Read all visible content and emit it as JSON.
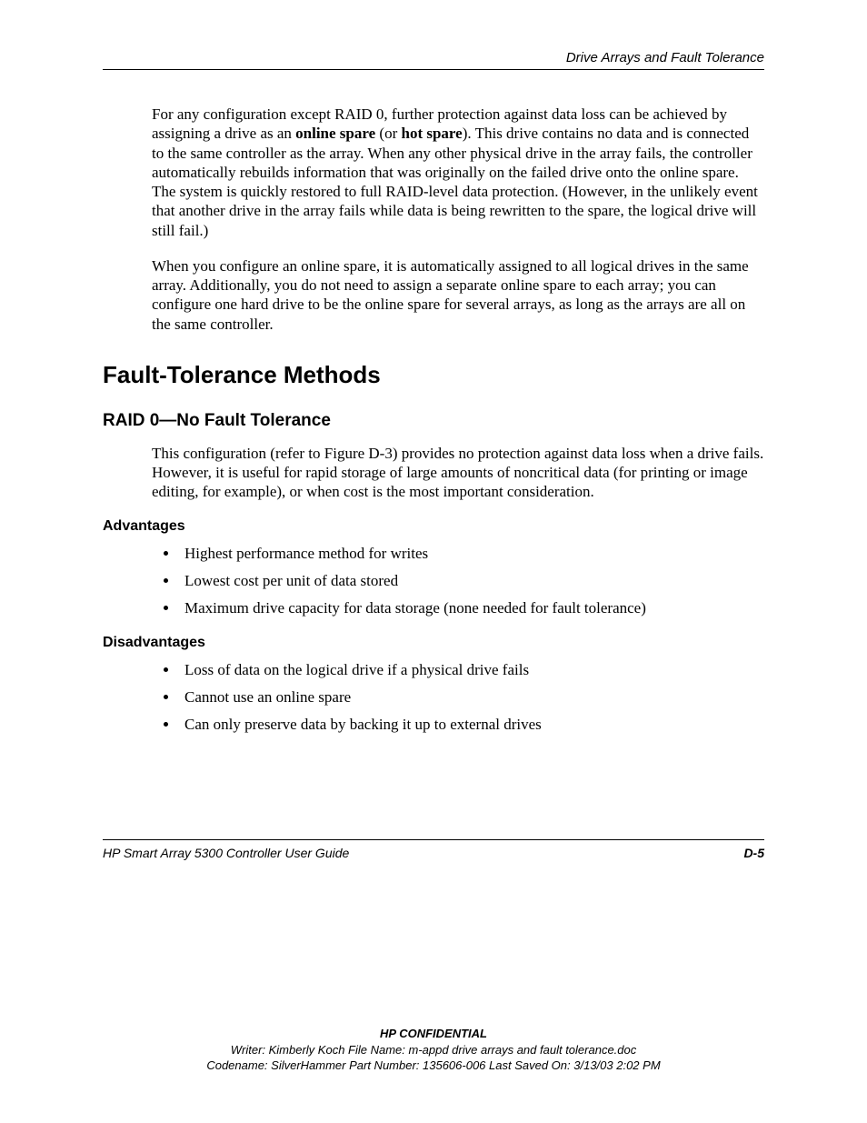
{
  "header": {
    "running_title": "Drive Arrays and Fault Tolerance"
  },
  "para1": {
    "t1": "For any configuration except RAID 0, further protection against data loss can be achieved by assigning a drive as an ",
    "b1": "online spare",
    "t2": " (or ",
    "b2": "hot spare",
    "t3": "). This drive contains no data and is connected to the same controller as the array. When any other physical drive in the array fails, the controller automatically rebuilds information that was originally on the failed drive onto the online spare. The system is quickly restored to full RAID-level data protection. (However, in the unlikely event that another drive in the array fails while data is being rewritten to the spare, the logical drive will still fail.)"
  },
  "para2": "When you configure an online spare, it is automatically assigned to all logical drives in the same array. Additionally, you do not need to assign a separate online spare to each array; you can configure one hard drive to be the online spare for several arrays, as long as the arrays are all on the same controller.",
  "h1": "Fault-Tolerance Methods",
  "h2": "RAID 0—No Fault Tolerance",
  "raid0_intro": "This configuration (refer to Figure D-3) provides no protection against data loss when a drive fails. However, it is useful for rapid storage of large amounts of noncritical data (for printing or image editing, for example), or when cost is the most important consideration.",
  "adv_heading": "Advantages",
  "advantages": [
    "Highest performance method for writes",
    "Lowest cost per unit of data stored",
    "Maximum drive capacity for data storage (none needed for fault tolerance)"
  ],
  "dis_heading": "Disadvantages",
  "disadvantages": [
    "Loss of data on the logical drive if a physical drive fails",
    "Cannot use an online spare",
    "Can only preserve data by backing it up to external drives"
  ],
  "footer": {
    "guide": "HP Smart Array 5300 Controller User Guide",
    "page": "D-5",
    "confidential": "HP CONFIDENTIAL",
    "writer_line": "Writer: Kimberly Koch File Name: m-appd drive arrays and fault tolerance.doc",
    "codename_line": "Codename: SilverHammer Part Number: 135606-006 Last Saved On: 3/13/03 2:02 PM"
  }
}
